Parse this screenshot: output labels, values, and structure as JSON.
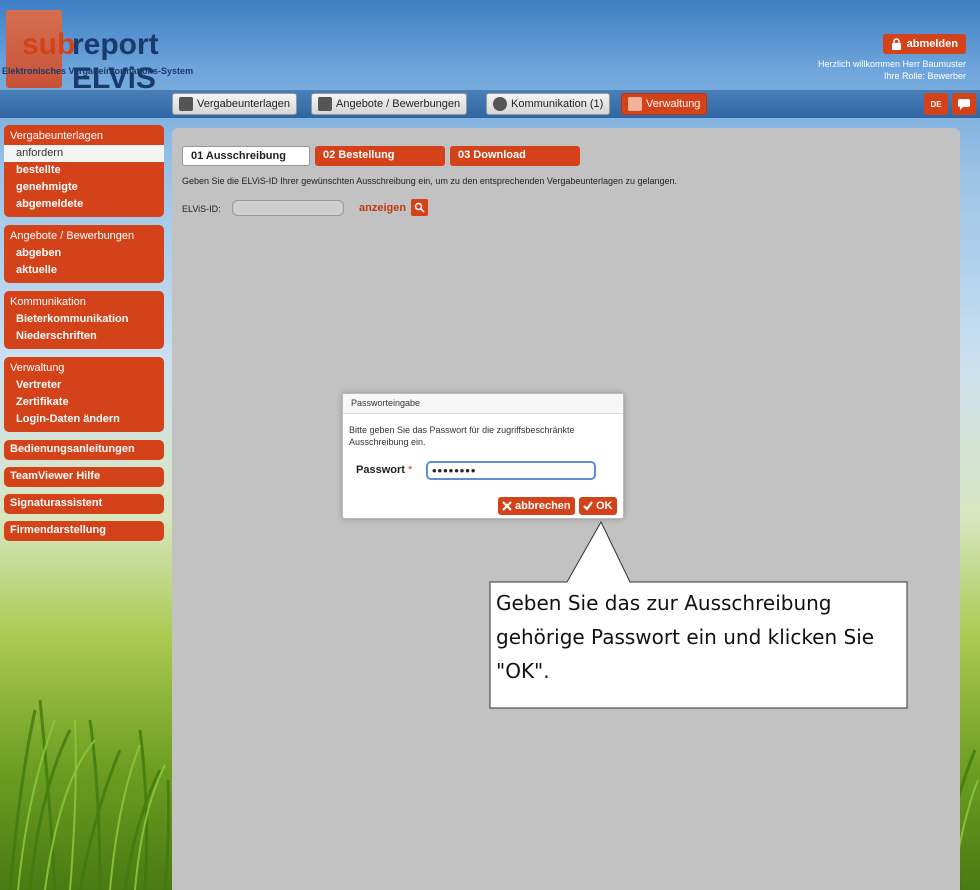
{
  "header": {
    "logo_sub": "sub",
    "logo_report": "report ELViS",
    "logo_tagline": "Elektronisches Vergabeinformations-System",
    "logout_label": "abmelden",
    "welcome_line": "Herzlich willkommen Herr Baumuster",
    "role_line": "Ihre Rolle: Bewerber"
  },
  "nav": {
    "items": [
      {
        "label": "Vergabeunterlagen",
        "icon": "documents-icon"
      },
      {
        "label": "Angebote / Bewerbungen",
        "icon": "envelope-icon"
      },
      {
        "label": "Kommunikation (1)",
        "icon": "person-icon"
      },
      {
        "label": "Verwaltung",
        "icon": "grid-icon"
      }
    ],
    "language": "DE"
  },
  "sidebar": {
    "groups": [
      {
        "title": "Vergabeunterlagen",
        "items": [
          "anfordern",
          "bestellte",
          "genehmigte",
          "abgemeldete"
        ]
      },
      {
        "title": "Angebote / Bewerbungen",
        "items": [
          "abgeben",
          "aktuelle"
        ]
      },
      {
        "title": "Kommunikation",
        "items": [
          "Bieterkommunikation",
          "Niederschriften"
        ]
      },
      {
        "title": "Verwaltung",
        "items": [
          "Vertreter",
          "Zertifikate",
          "Login-Daten ändern"
        ]
      }
    ],
    "singles": [
      "Bedienungsanleitungen",
      "TeamViewer Hilfe",
      "Signaturassistent",
      "Firmendarstellung"
    ]
  },
  "main": {
    "tabs": [
      "01 Ausschreibung",
      "02 Bestellung",
      "03 Download"
    ],
    "info_text": "Geben Sie die ELViS-ID Ihrer gewünschten Ausschreibung ein, um zu den entsprechenden Vergabeunterlagen zu gelangen.",
    "elvis_label": "ELViS-ID:",
    "elvis_value": "",
    "show_label": "anzeigen"
  },
  "dialog": {
    "title": "Passworteingabe",
    "message": "Bitte geben Sie das Passwort für die zugriffsbeschränkte Ausschreibung ein.",
    "password_label": "Passwort",
    "required_mark": "*",
    "password_value": "••••••••",
    "cancel_label": "abbrechen",
    "ok_label": "OK"
  },
  "callout": {
    "text": "Geben Sie das zur Ausschreibung gehörige Passwort ein und klicken Sie \"OK\"."
  },
  "colors": {
    "accent": "#d4421a",
    "navbar": "#2f66a3",
    "panel": "#c2c2c2"
  }
}
